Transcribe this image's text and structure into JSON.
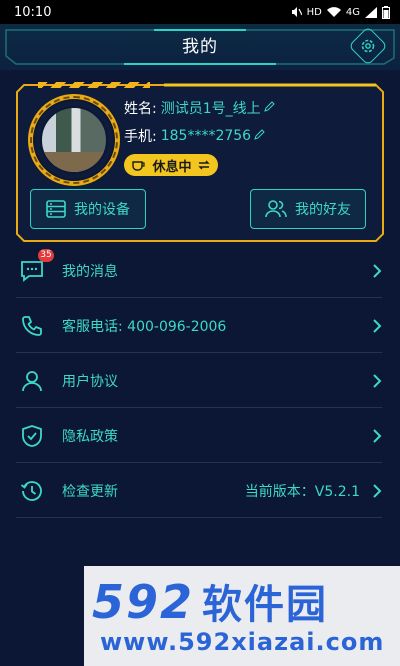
{
  "status_bar": {
    "time": "10:10",
    "network_label": "HD",
    "signal_label": "4G"
  },
  "header": {
    "title": "我的"
  },
  "profile": {
    "name_label": "姓名:",
    "name_value": "测试员1号_线上",
    "phone_label": "手机:",
    "phone_value": "185****2756",
    "status_text": "休息中",
    "buttons": [
      {
        "label": "我的设备"
      },
      {
        "label": "我的好友"
      }
    ]
  },
  "menu": [
    {
      "label": "我的消息",
      "badge": "35",
      "icon": "message-icon"
    },
    {
      "label": "客服电话: 400-096-2006",
      "icon": "phone-icon"
    },
    {
      "label": "用户协议",
      "icon": "user-icon"
    },
    {
      "label": "隐私政策",
      "icon": "shield-check-icon"
    },
    {
      "label": "检查更新",
      "value": "当前版本：V5.2.1",
      "icon": "history-icon"
    }
  ],
  "watermark": {
    "logo": "592",
    "logo_cn": "软件园",
    "url": "www.592xiazai.com"
  },
  "colors": {
    "accent": "#3dd8c6",
    "background": "#0b1735",
    "status_pill": "#f3c51f",
    "frame_gold": "#e9aa14"
  }
}
